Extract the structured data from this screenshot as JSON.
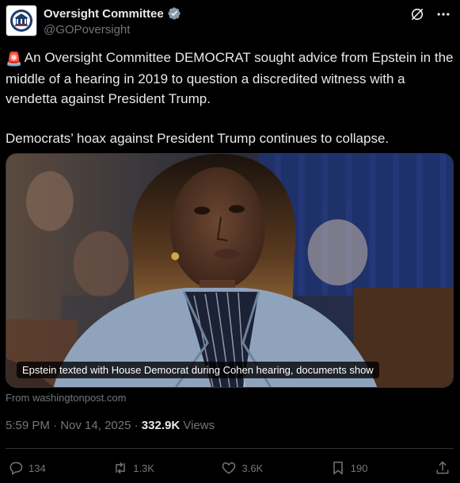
{
  "author": {
    "display_name": "Oversight Committee",
    "handle": "@GOPoversight",
    "verified": true,
    "badge_color": "#829aab"
  },
  "tweet": {
    "emoji": "🚨",
    "line1": "An Oversight Committee DEMOCRAT sought advice from Epstein in the middle of a hearing in 2019 to question a discredited witness with a vendetta against President Trump.",
    "line2": "Democrats’ hoax against President Trump continues to collapse."
  },
  "media": {
    "caption": "Epstein texted with House Democrat during Cohen hearing, documents show",
    "source": "From washingtonpost.com"
  },
  "meta": {
    "time": "5:59 PM",
    "date": "Nov 14, 2025",
    "separator": "·",
    "views_count": "332.9K",
    "views_label": "Views"
  },
  "actions": {
    "replies": "134",
    "reposts": "1.3K",
    "likes": "3.6K",
    "bookmarks": "190"
  },
  "colors": {
    "background": "#000000",
    "text": "#e7e9ea",
    "muted": "#71767b",
    "border": "#2f3336"
  }
}
